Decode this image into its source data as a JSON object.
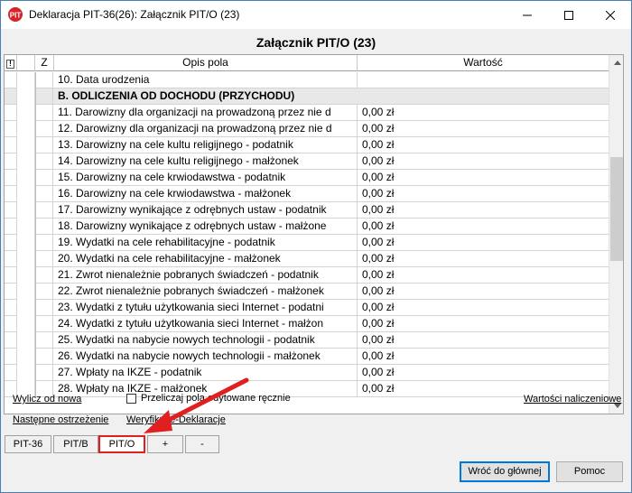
{
  "window": {
    "title": "Deklaracja PIT-36(26): Załącznik PIT/O (23)",
    "accent": "#e02020"
  },
  "header": {
    "title": "Załącznik PIT/O (23)"
  },
  "grid": {
    "columns": {
      "flag": "!",
      "z": "Z",
      "description": "Opis pola",
      "value": "Wartość"
    },
    "rows": [
      {
        "type": "item",
        "label": "10. Data urodzenia",
        "value": ""
      },
      {
        "type": "section",
        "label": "B. ODLICZENIA OD DOCHODU (PRZYCHODU)",
        "value": ""
      },
      {
        "type": "item",
        "label": "11. Darowizny dla organizacji na prowadzoną przez nie d",
        "value": "0,00 zł"
      },
      {
        "type": "item",
        "label": "12. Darowizny dla organizacji na prowadzoną przez nie d",
        "value": "0,00 zł"
      },
      {
        "type": "item",
        "label": "13. Darowizny na cele kultu religijnego - podatnik",
        "value": "0,00 zł"
      },
      {
        "type": "item",
        "label": "14. Darowizny na cele kultu religijnego - małżonek",
        "value": "0,00 zł"
      },
      {
        "type": "item",
        "label": "15. Darowizny na cele krwiodawstwa - podatnik",
        "value": "0,00 zł"
      },
      {
        "type": "item",
        "label": "16. Darowizny na cele krwiodawstwa - małżonek",
        "value": "0,00 zł"
      },
      {
        "type": "item",
        "label": "17. Darowizny wynikające z odrębnych ustaw - podatnik",
        "value": "0,00 zł"
      },
      {
        "type": "item",
        "label": "18. Darowizny wynikające z odrębnych ustaw - małżone",
        "value": "0,00 zł"
      },
      {
        "type": "item",
        "label": "19. Wydatki na cele rehabilitacyjne - podatnik",
        "value": "0,00 zł"
      },
      {
        "type": "item",
        "label": "20. Wydatki na cele rehabilitacyjne - małżonek",
        "value": "0,00 zł"
      },
      {
        "type": "item",
        "label": "21. Zwrot nienależnie pobranych świadczeń - podatnik",
        "value": "0,00 zł"
      },
      {
        "type": "item",
        "label": "22. Zwrot nienależnie pobranych świadczeń - małżonek",
        "value": "0,00 zł"
      },
      {
        "type": "item",
        "label": "23. Wydatki z tytułu użytkowania sieci Internet - podatni",
        "value": "0,00 zł"
      },
      {
        "type": "item",
        "label": "24. Wydatki z tytułu użytkowania sieci Internet - małżon",
        "value": "0,00 zł"
      },
      {
        "type": "item",
        "label": "25. Wydatki na nabycie nowych technologii - podatnik",
        "value": "0,00 zł"
      },
      {
        "type": "item",
        "label": "26. Wydatki na nabycie nowych technologii - małżonek",
        "value": "0,00 zł"
      },
      {
        "type": "item",
        "label": "27. Wpłaty na IKZE - podatnik",
        "value": "0,00 zł"
      },
      {
        "type": "item",
        "label": "28. Wpłaty na IKZE - małżonek",
        "value": "0,00 zł"
      }
    ]
  },
  "footer": {
    "recalc_link": "Wylicz od nowa",
    "recalc_checkbox_label": "Przeliczaj pola edytowane ręcznie",
    "recalc_checked": false,
    "computed_values_link": "Wartości naliczeniowe",
    "next_warning_link": "Następne ostrzeżenie",
    "verify_link": "Weryfikuj e-Deklaracje"
  },
  "tabs": [
    {
      "label": "PIT-36",
      "active": false
    },
    {
      "label": "PIT/B",
      "active": false
    },
    {
      "label": "PIT/O",
      "active": true
    },
    {
      "label": "+",
      "active": false
    },
    {
      "label": "-",
      "active": false
    }
  ],
  "buttons": {
    "back": "Wróć do głównej",
    "help": "Pomoc"
  }
}
